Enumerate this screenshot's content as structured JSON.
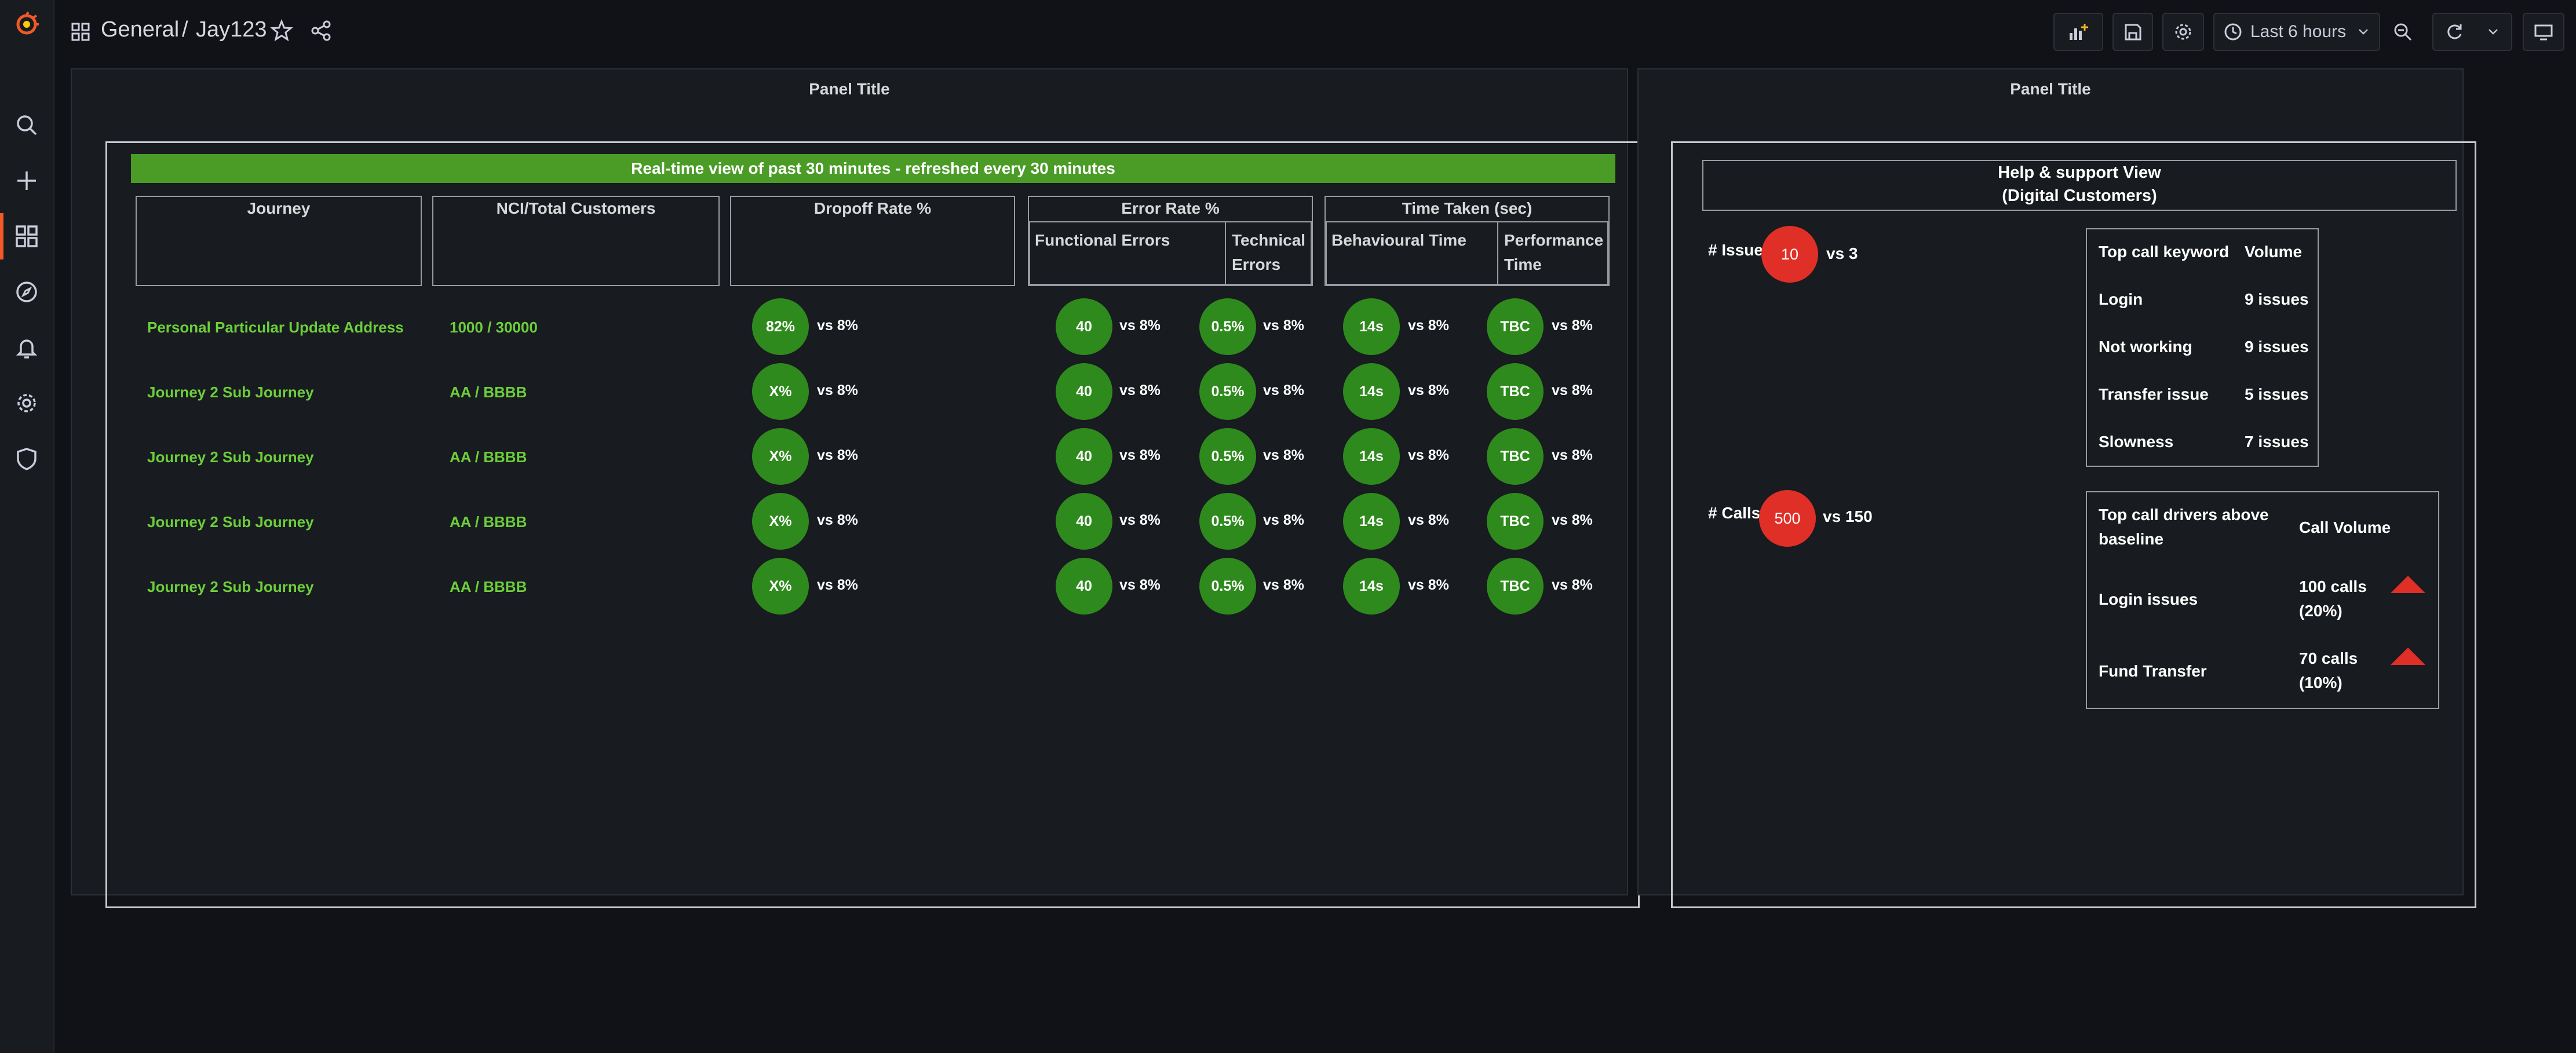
{
  "breadcrumb": {
    "folder": "General",
    "separator": "/",
    "dashboard": "Jay123"
  },
  "toolbar": {
    "time_range": "Last 6 hours"
  },
  "panels": {
    "left": {
      "title": "Panel Title",
      "banner": "Real-time view of past 30 minutes - refreshed every 30 minutes",
      "headers": {
        "journey": "Journey",
        "nci": "NCI/Total Customers",
        "dropoff": "Dropoff Rate %",
        "error_rate": "Error Rate %",
        "functional_errors": "Functional Errors",
        "technical_errors_1": "Technical",
        "technical_errors_2": "Errors",
        "time_taken": "Time Taken (sec)",
        "behavioural_time": "Behavioural Time",
        "performance_time_1": "Performance",
        "performance_time_2": "Time"
      },
      "rows": [
        {
          "journey": "Personal Particular Update Address",
          "nci": "1000 / 30000",
          "dropoff": "82%",
          "dropoff_vs": "vs 8%",
          "functional": "40",
          "functional_vs": "vs 8%",
          "technical": "0.5%",
          "technical_vs": "vs 8%",
          "behavioural": "14s",
          "behavioural_vs": "vs 8%",
          "performance": "TBC",
          "performance_vs": "vs 8%"
        },
        {
          "journey": "Journey 2 Sub Journey",
          "nci": "AA / BBBB",
          "dropoff": "X%",
          "dropoff_vs": "vs 8%",
          "functional": "40",
          "functional_vs": "vs 8%",
          "technical": "0.5%",
          "technical_vs": "vs 8%",
          "behavioural": "14s",
          "behavioural_vs": "vs 8%",
          "performance": "TBC",
          "performance_vs": "vs 8%"
        },
        {
          "journey": "Journey 2 Sub Journey",
          "nci": "AA / BBBB",
          "dropoff": "X%",
          "dropoff_vs": "vs 8%",
          "functional": "40",
          "functional_vs": "vs 8%",
          "technical": "0.5%",
          "technical_vs": "vs 8%",
          "behavioural": "14s",
          "behavioural_vs": "vs 8%",
          "performance": "TBC",
          "performance_vs": "vs 8%"
        },
        {
          "journey": "Journey 2 Sub Journey",
          "nci": "AA / BBBB",
          "dropoff": "X%",
          "dropoff_vs": "vs 8%",
          "functional": "40",
          "functional_vs": "vs 8%",
          "technical": "0.5%",
          "technical_vs": "vs 8%",
          "behavioural": "14s",
          "behavioural_vs": "vs 8%",
          "performance": "TBC",
          "performance_vs": "vs 8%"
        },
        {
          "journey": "Journey 2 Sub Journey",
          "nci": "AA / BBBB",
          "dropoff": "X%",
          "dropoff_vs": "vs 8%",
          "functional": "40",
          "functional_vs": "vs 8%",
          "technical": "0.5%",
          "technical_vs": "vs 8%",
          "behavioural": "14s",
          "behavioural_vs": "vs 8%",
          "performance": "TBC",
          "performance_vs": "vs 8%"
        }
      ]
    },
    "right": {
      "title": "Panel Title",
      "help_title": "Help & support View",
      "help_subtitle": "(Digital Customers)",
      "issue": {
        "label": "# Issue",
        "value": "10",
        "compare": "vs 3"
      },
      "calls": {
        "label": "# Calls",
        "value": "500",
        "compare": "vs 150"
      },
      "keywords": {
        "col1": "Top call keyword",
        "col2": "Volume",
        "rows": [
          {
            "keyword": "Login",
            "volume": "9 issues"
          },
          {
            "keyword": "Not working",
            "volume": "9 issues"
          },
          {
            "keyword": "Transfer issue",
            "volume": "5 issues"
          },
          {
            "keyword": "Slowness",
            "volume": "7 issues"
          }
        ]
      },
      "drivers": {
        "col1_line1": "Top call drivers above",
        "col1_line2": "baseline",
        "col2": "Call Volume",
        "rows": [
          {
            "driver": "Login issues",
            "volume_line1": "100 calls",
            "volume_line2": "(20%)"
          },
          {
            "driver": "Fund Transfer",
            "volume_line1": "70 calls",
            "volume_line2": "(10%)"
          }
        ]
      }
    }
  },
  "colors": {
    "accent": "#f05a28",
    "banner_green": "#4a9c26",
    "metric_green": "#2f8a1d",
    "label_green": "#6ccf3a",
    "alert_red": "#e02f27"
  }
}
